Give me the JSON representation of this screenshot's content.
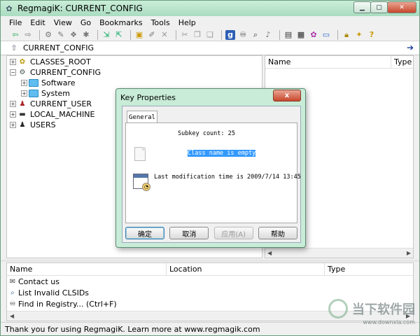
{
  "window": {
    "title": "RegmagiK: CURRENT_CONFIG",
    "min_icon": "minimize-icon",
    "max_icon": "maximize-icon",
    "close_icon": "close-icon"
  },
  "menubar": {
    "items": [
      "File",
      "Edit",
      "View",
      "Go",
      "Bookmarks",
      "Tools",
      "Help"
    ]
  },
  "address": {
    "value": "CURRENT_CONFIG"
  },
  "tree": {
    "items": [
      {
        "label": "CLASSES_ROOT",
        "expander": "+",
        "icon": "classes-root-icon"
      },
      {
        "label": "CURRENT_CONFIG",
        "expander": "−",
        "icon": "current-config-icon"
      },
      {
        "label": "Software",
        "expander": "+",
        "icon": "folder-icon"
      },
      {
        "label": "System",
        "expander": "+",
        "icon": "folder-icon"
      },
      {
        "label": "CURRENT_USER",
        "expander": "+",
        "icon": "user-icon"
      },
      {
        "label": "LOCAL_MACHINE",
        "expander": "+",
        "icon": "computer-icon"
      },
      {
        "label": "USERS",
        "expander": "+",
        "icon": "users-icon"
      }
    ]
  },
  "list": {
    "columns": [
      "Name",
      "Type"
    ]
  },
  "bottom": {
    "columns": [
      "Name",
      "Location",
      "Type"
    ],
    "rows": [
      {
        "label": "Contact us",
        "icon": "envelope-icon"
      },
      {
        "label": "List Invalid CLSIDs",
        "icon": "search-icon"
      },
      {
        "label": "Find in Registry...   (Ctrl+F)",
        "icon": "binoculars-icon"
      }
    ]
  },
  "status": {
    "text": "Thank you for using RegmagiK. Learn more at www.regmagik.com"
  },
  "dialog": {
    "title": "Key Properties",
    "close_label": "x",
    "tab": "General",
    "subkey_count": "Subkey count: 25",
    "class_name": "Class name is empty",
    "last_modified": "Last modification time is 2009/7/14 13:45",
    "buttons": {
      "ok": "确定",
      "cancel": "取消",
      "apply": "应用(A)",
      "help": "帮助"
    }
  },
  "watermark": {
    "text": "当下软件园",
    "url": "www.downxia.com"
  }
}
